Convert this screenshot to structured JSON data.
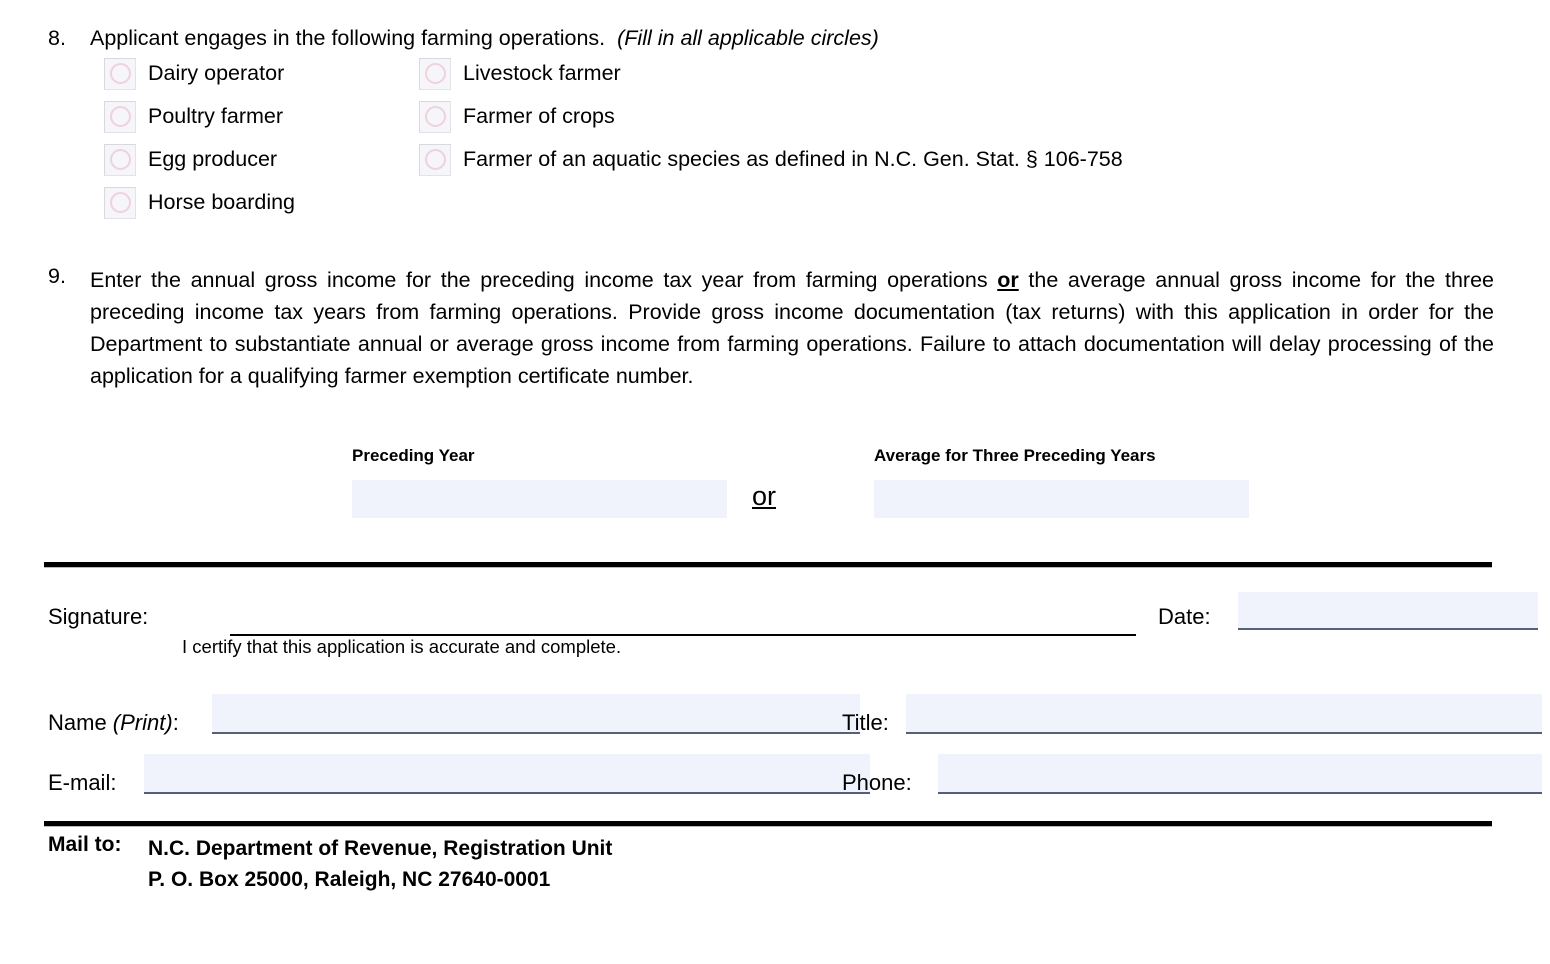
{
  "form": {
    "item8": {
      "number": "8.",
      "text": "Applicant engages in the following farming operations.",
      "hint": "(Fill in all applicable circles)",
      "options_left": [
        {
          "label": "Dairy operator",
          "checked": false
        },
        {
          "label": "Poultry farmer",
          "checked": false
        },
        {
          "label": "Egg producer",
          "checked": false
        },
        {
          "label": "Horse boarding",
          "checked": false
        }
      ],
      "options_right": [
        {
          "label": "Livestock farmer",
          "checked": false
        },
        {
          "label": "Farmer of crops",
          "checked": false
        },
        {
          "label": "Farmer of an aquatic species as defined in N.C. Gen. Stat. § 106-758",
          "checked": false
        }
      ]
    },
    "item9": {
      "number": "9.",
      "text_part1": "Enter the annual gross income for the preceding income tax year from farming operations ",
      "emphasis": "or",
      "text_part2": " the average annual gross income for the three preceding income tax years from farming operations.  Provide gross income documentation (tax returns) with this application in order for the Department to substantiate annual or average gross income from farming operations.  Failure to attach documentation will delay processing of the application for a qualifying farmer exemption certificate number.",
      "preceding_year_label": "Preceding Year",
      "preceding_year_value": "",
      "or_separator": "or",
      "average_label": "Average for Three Preceding Years",
      "average_value": ""
    },
    "signature": {
      "signature_label": "Signature:",
      "signature_value": "",
      "certify_text": "I certify that this application is accurate and complete.",
      "date_label": "Date:",
      "date_value": "",
      "name_label": "Name ",
      "name_label_italic": "(Print)",
      "name_label_colon": ":",
      "name_value": "",
      "title_label": "Title:",
      "title_value": "",
      "email_label": "E-mail:",
      "email_value": "",
      "phone_label": "Phone:",
      "phone_value": ""
    },
    "mailto": {
      "label": "Mail to:",
      "line1": "N.C. Department of Revenue, Registration Unit",
      "line2": "P. O. Box 25000, Raleigh, NC 27640-0001"
    }
  },
  "colors": {
    "field_fill": "#f0f2fc",
    "field_underline": "#555f7a",
    "circle_outline": "#eed2dc",
    "checkbox_fill": "#f5f5fa",
    "rule": "#000000"
  }
}
